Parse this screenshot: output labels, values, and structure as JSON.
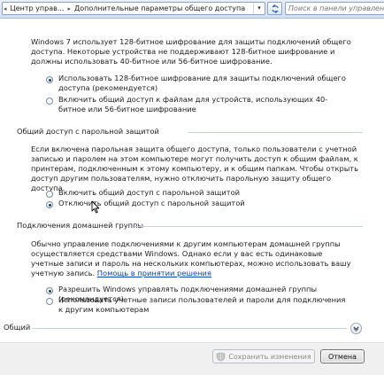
{
  "address_bar": {
    "breadcrumb_1": "Центр управ...",
    "breadcrumb_2": "Дополнительные параметры общего доступа",
    "search_placeholder": "Поиск в панели управления"
  },
  "encryption": {
    "description": "Windows 7 использует 128-битное шифрование для защиты подключений общего доступа. Некоторые устройства не поддерживают 128-битное шифрование и должны использовать 40-битное или 56-битное шифрование.",
    "options": [
      {
        "label": "Использовать 128-битное шифрование для защиты подключений общего доступа (рекомендуется)",
        "selected": true
      },
      {
        "label": "Включить общий доступ к файлам для устройств, использующих 40-битное или 56-битное шифрование",
        "selected": false
      }
    ]
  },
  "password_sharing": {
    "header": "Общий доступ с парольной защитой",
    "description": "Если включена парольная защита общего доступа, только пользователи с учетной записью и паролем на этом компьютере могут получить доступ к общим файлам, к принтерам, подключенным к этому компьютеру, и к общим папкам. Чтобы открыть доступ другим пользователям, нужно отключить парольную защиту общего доступа.",
    "options": [
      {
        "label": "Включить общий доступ с парольной защитой",
        "selected": false
      },
      {
        "label": "Отключить общий доступ с парольной защитой",
        "selected": true
      }
    ]
  },
  "homegroup": {
    "header": "Подключения домашней группы",
    "description": "Обычно управление подключениями к другим компьютерам домашней группы осуществляется средствами Windows. Однако если у вас есть одинаковые учетные записи и пароль на нескольких компьютерах, можно использовать вашу учетную запись.",
    "help_link": "Помощь в принятии решения",
    "options": [
      {
        "label": "Разрешить Windows управлять подключениями домашней группы (рекомендуется)",
        "selected": true
      },
      {
        "label": "Использовать учетные записи пользователей и пароли для подключения к другим компьютерам",
        "selected": false
      }
    ]
  },
  "general": {
    "header": "Общий"
  },
  "footer": {
    "save_label": "Сохранить изменения",
    "cancel_label": "Отмена"
  },
  "colors": {
    "link": "#0645ad",
    "topbar": "#d2e0f1"
  }
}
